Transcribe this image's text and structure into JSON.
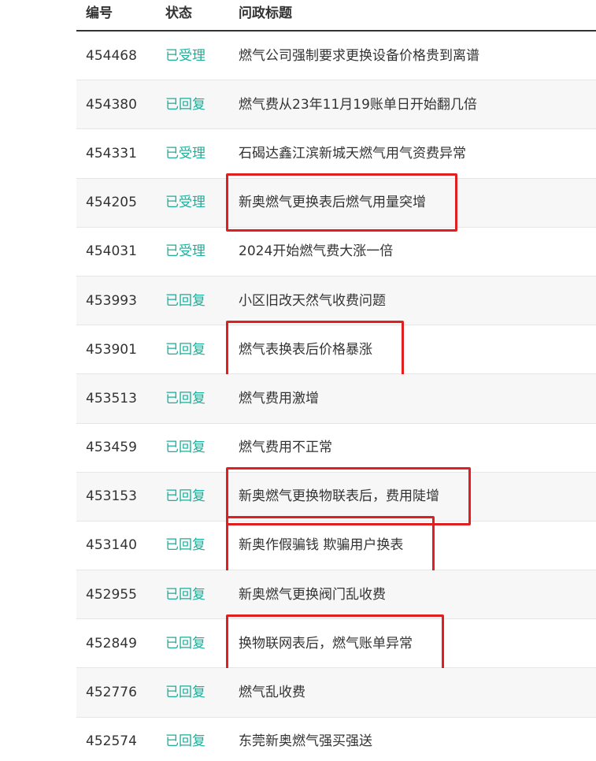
{
  "table": {
    "headers": {
      "id": "编号",
      "status": "状态",
      "title": "问政标题"
    },
    "rows": [
      {
        "id": "454468",
        "status": "已受理",
        "title": "燃气公司强制要求更换设备价格贵到离谱",
        "highlighted": false
      },
      {
        "id": "454380",
        "status": "已回复",
        "title": "燃气费从23年11月19账单日开始翻几倍",
        "highlighted": false
      },
      {
        "id": "454331",
        "status": "已受理",
        "title": "石碣达鑫江滨新城天燃气用气资费异常",
        "highlighted": false
      },
      {
        "id": "454205",
        "status": "已受理",
        "title": "新奥燃气更换表后燃气用量突增",
        "highlighted": true
      },
      {
        "id": "454031",
        "status": "已受理",
        "title": "2024开始燃气费大涨一倍",
        "highlighted": false
      },
      {
        "id": "453993",
        "status": "已回复",
        "title": "小区旧改天然气收费问题",
        "highlighted": false
      },
      {
        "id": "453901",
        "status": "已回复",
        "title": "燃气表换表后价格暴涨",
        "highlighted": true
      },
      {
        "id": "453513",
        "status": "已回复",
        "title": "燃气费用激增",
        "highlighted": false
      },
      {
        "id": "453459",
        "status": "已回复",
        "title": "燃气费用不正常",
        "highlighted": false
      },
      {
        "id": "453153",
        "status": "已回复",
        "title": "新奥燃气更换物联表后，费用陡增",
        "highlighted": true
      },
      {
        "id": "453140",
        "status": "已回复",
        "title": "新奥作假骗钱 欺骗用户换表",
        "highlighted": true
      },
      {
        "id": "452955",
        "status": "已回复",
        "title": "新奥燃气更换阀门乱收费",
        "highlighted": false
      },
      {
        "id": "452849",
        "status": "已回复",
        "title": "换物联网表后，燃气账单异常",
        "highlighted": true
      },
      {
        "id": "452776",
        "status": "已回复",
        "title": "燃气乱收费",
        "highlighted": false
      },
      {
        "id": "452574",
        "status": "已回复",
        "title": "东莞新奥燃气强买强送",
        "highlighted": false
      }
    ]
  },
  "colors": {
    "status_text": "#1aaf9a",
    "highlight_box": "#e02020",
    "row_alt_bg": "#f7f7f7",
    "text": "#333333"
  }
}
